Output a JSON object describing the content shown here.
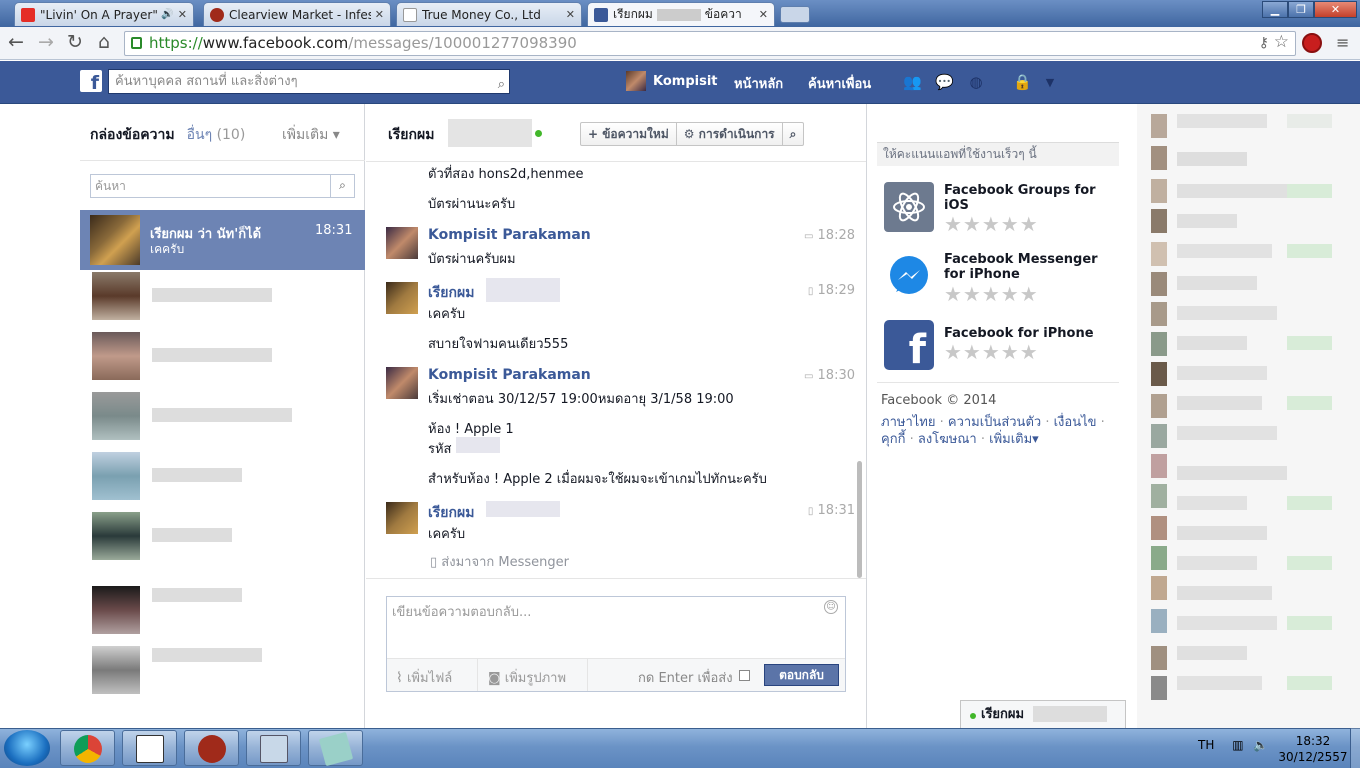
{
  "browser": {
    "tabs": [
      {
        "title": "\"Livin' On A Prayer\" - B",
        "icon": "youtube-icon"
      },
      {
        "title": "Clearview Market - Infesta",
        "icon": "game-icon"
      },
      {
        "title": "True Money Co., Ltd",
        "icon": "page-icon"
      },
      {
        "title": "เรียกผม",
        "title_suffix": "ข้อควา",
        "icon": "facebook-icon"
      }
    ],
    "url_scheme": "https://",
    "url_host": "www.facebook.com",
    "url_path": "/messages/100001277098390"
  },
  "fb": {
    "search_placeholder": "ค้นหาบุคคล สถานที่ และสิ่งต่างๆ",
    "profile_name": "Kompisit",
    "nav_home": "หน้าหลัก",
    "nav_find_friends": "ค้นหาเพื่อน",
    "brand_color": "#3b5998"
  },
  "inbox": {
    "label": "กล่องข้อความ",
    "other_label": "อื่นๆ",
    "other_count": "(10)",
    "more_label": "เพิ่มเติม ▾",
    "search_placeholder": "ค้นหา",
    "selected_thread": {
      "name": "เรียกผม ว่า นัท'ก็ได้",
      "snippet": "เคครับ",
      "time": "18:31"
    }
  },
  "conversation": {
    "title": "เรียกผม",
    "new_message_label": "+ ข้อความใหม่",
    "actions_label": "⚙ การดำเนินการ",
    "messages": {
      "m0_line1": "ตัวที่สอง hons2d,henmee",
      "m0_line2": "บัตรผ่านนะครับ",
      "m1_sender": "Kompisit Parakaman",
      "m1_time": "18:28",
      "m1_line1": "บัตรผ่านครับผม",
      "m2_sender": "เรียกผม",
      "m2_time": "18:29",
      "m2_line1": "เคครับ",
      "m2_line2": "สบายใจฟามคนเดียว555",
      "m3_sender": "Kompisit Parakaman",
      "m3_time": "18:30",
      "m3_line1": "เริ่มเช่าตอน 30/12/57 19:00หมดอายุ 3/1/58 19:00",
      "m3_line2": "ห้อง ! Apple 1",
      "m3_line3": "รหัส",
      "m3_line4": "สำหรับห้อง ! Apple 2 เมื่อผมจะใช้ผมจะเข้าเกมไปทักนะครับ",
      "m4_sender": "เรียกผม",
      "m4_time": "18:31",
      "m4_line1": "เคครับ",
      "m4_via": "ส่งมาจาก Messenger"
    },
    "reply_placeholder": "เขียนข้อความตอบกลับ...",
    "attach_label": "เพิ่มไฟล์",
    "photo_label": "เพิ่มรูปภาพ",
    "enter_label": "กด Enter เพื่อส่ง",
    "reply_button": "ตอบกลับ"
  },
  "sidebar": {
    "apps_header": "ให้คะแนนแอพที่ใช้งานเร็วๆ นี้",
    "apps": [
      {
        "title": "Facebook Groups for iOS",
        "stars": "★★★★★"
      },
      {
        "title": "Facebook Messenger for iPhone",
        "stars": "★★★★★"
      },
      {
        "title": "Facebook for iPhone",
        "stars": "★★★★★"
      }
    ],
    "copyright": "Facebook © 2014",
    "links": {
      "l1": "ภาษาไทย",
      "l2": "ความเป็นส่วนตัว",
      "l3": "เงื่อนไข",
      "l4": "คุกกี้",
      "l5": "ลงโฆษณา",
      "l6": "เพิ่มเติม▾"
    }
  },
  "chat_tab": {
    "name": "เรียกผม"
  },
  "taskbar": {
    "lang": "TH",
    "time": "18:32",
    "date": "30/12/2557"
  }
}
